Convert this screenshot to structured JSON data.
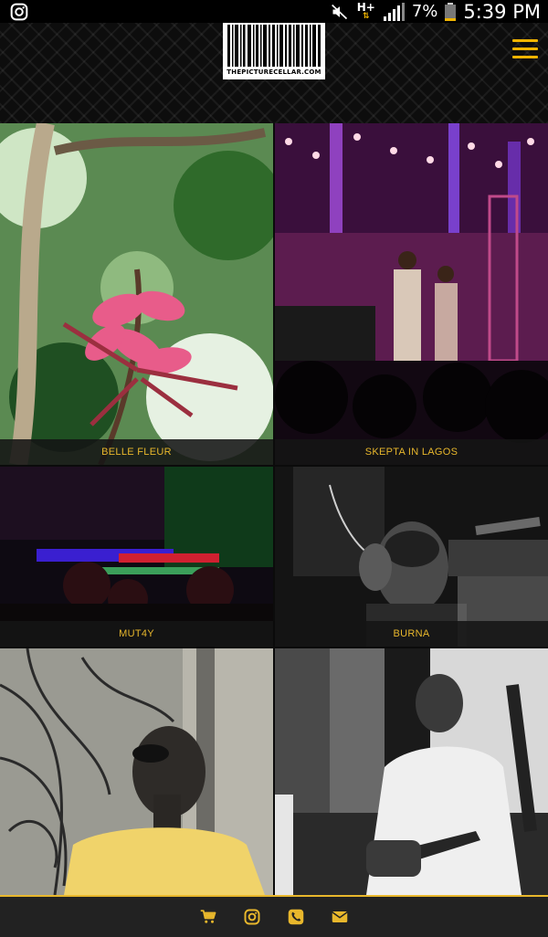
{
  "status_bar": {
    "left_icon": "instagram-icon",
    "network": "H+",
    "battery_percent": "7%",
    "time": "5:39 PM"
  },
  "header": {
    "logo_text": "THEPICTURECELLAR.COM",
    "menu_icon": "hamburger-icon",
    "accent_color": "#f0b400"
  },
  "gallery": {
    "items": [
      {
        "label": "BELLE FLEUR"
      },
      {
        "label": "SKEPTA IN LAGOS"
      },
      {
        "label": "MUT4Y"
      },
      {
        "label": "BURNA"
      },
      {
        "label": ""
      },
      {
        "label": ""
      }
    ]
  },
  "footer": {
    "icons": [
      "cart-icon",
      "instagram-icon",
      "phone-icon",
      "envelope-icon"
    ],
    "icon_color": "#e8b72c"
  }
}
